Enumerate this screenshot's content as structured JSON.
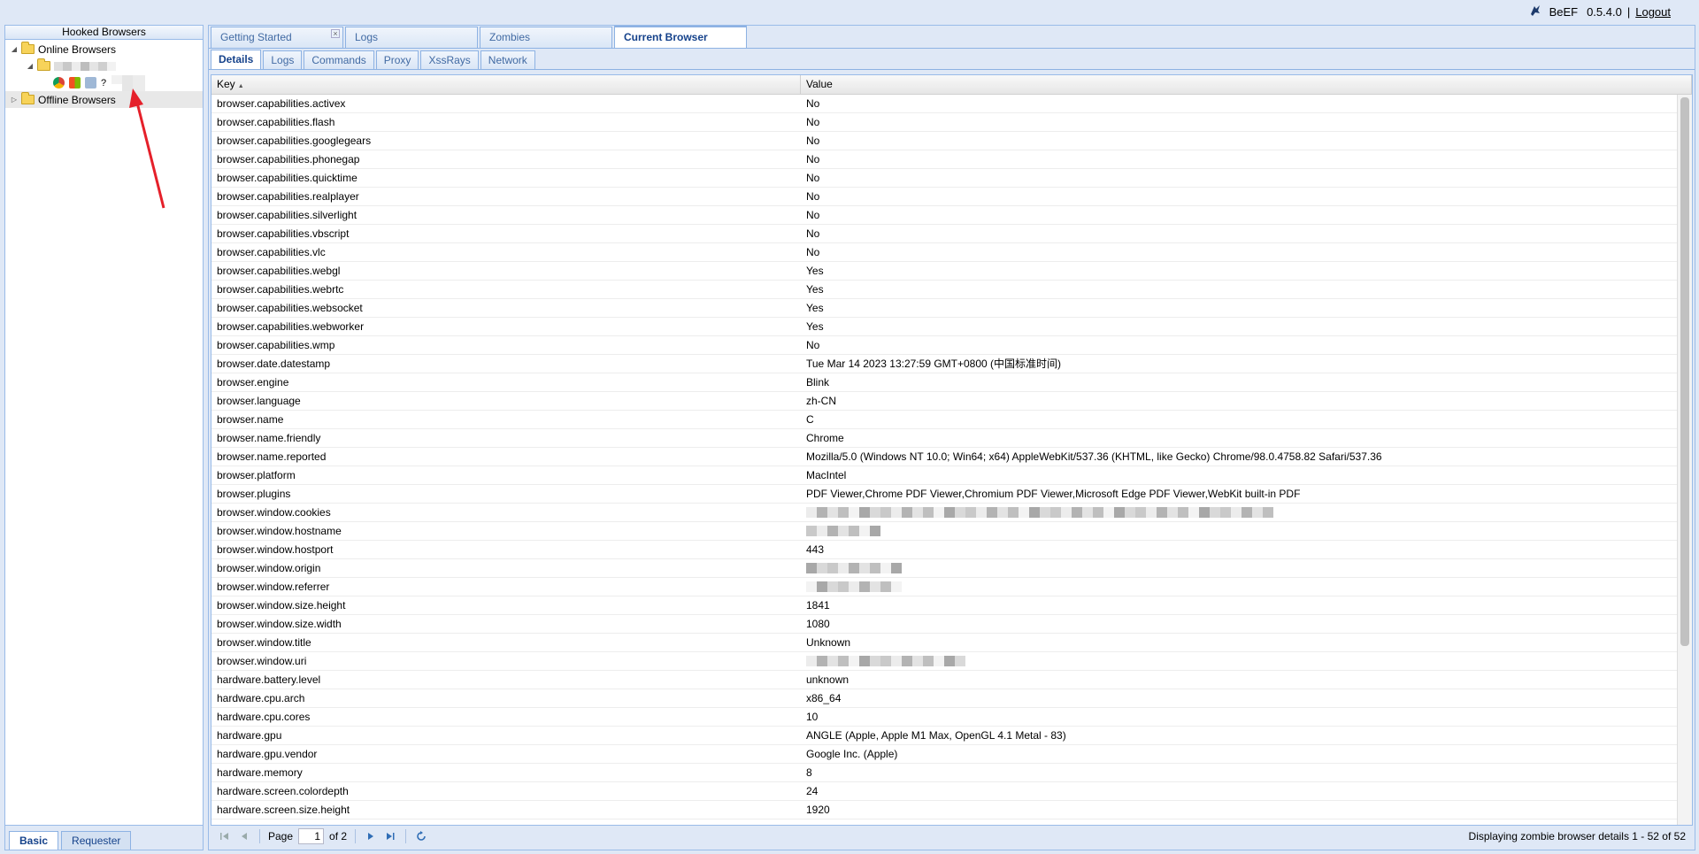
{
  "header": {
    "brand": "BeEF",
    "version": "0.5.4.0",
    "separator": "|",
    "logout_label": "Logout"
  },
  "west": {
    "title": "Hooked Browsers",
    "online_label": "Online Browsers",
    "offline_label": "Offline Browsers",
    "unknown_glyph": "?",
    "tabs": [
      "Basic",
      "Requester"
    ]
  },
  "main_tabs": [
    {
      "label": "Getting Started",
      "closable": true
    },
    {
      "label": "Logs"
    },
    {
      "label": "Zombies"
    },
    {
      "label": "Current Browser",
      "active": true
    }
  ],
  "sub_tabs": [
    {
      "label": "Details",
      "active": true
    },
    {
      "label": "Logs"
    },
    {
      "label": "Commands"
    },
    {
      "label": "Proxy"
    },
    {
      "label": "XssRays"
    },
    {
      "label": "Network"
    }
  ],
  "grid": {
    "col_key": "Key",
    "col_value": "Value",
    "rows": [
      {
        "k": "browser.capabilities.activex",
        "v": "No"
      },
      {
        "k": "browser.capabilities.flash",
        "v": "No"
      },
      {
        "k": "browser.capabilities.googlegears",
        "v": "No"
      },
      {
        "k": "browser.capabilities.phonegap",
        "v": "No"
      },
      {
        "k": "browser.capabilities.quicktime",
        "v": "No"
      },
      {
        "k": "browser.capabilities.realplayer",
        "v": "No"
      },
      {
        "k": "browser.capabilities.silverlight",
        "v": "No"
      },
      {
        "k": "browser.capabilities.vbscript",
        "v": "No"
      },
      {
        "k": "browser.capabilities.vlc",
        "v": "No"
      },
      {
        "k": "browser.capabilities.webgl",
        "v": "Yes"
      },
      {
        "k": "browser.capabilities.webrtc",
        "v": "Yes"
      },
      {
        "k": "browser.capabilities.websocket",
        "v": "Yes"
      },
      {
        "k": "browser.capabilities.webworker",
        "v": "Yes"
      },
      {
        "k": "browser.capabilities.wmp",
        "v": "No"
      },
      {
        "k": "browser.date.datestamp",
        "v": "Tue Mar 14 2023 13:27:59 GMT+0800 (中国标准时间)"
      },
      {
        "k": "browser.engine",
        "v": "Blink"
      },
      {
        "k": "browser.language",
        "v": "zh-CN"
      },
      {
        "k": "browser.name",
        "v": "C"
      },
      {
        "k": "browser.name.friendly",
        "v": "Chrome"
      },
      {
        "k": "browser.name.reported",
        "v": "Mozilla/5.0 (Windows NT 10.0; Win64; x64) AppleWebKit/537.36 (KHTML, like Gecko) Chrome/98.0.4758.82 Safari/537.36"
      },
      {
        "k": "browser.platform",
        "v": "MacIntel"
      },
      {
        "k": "browser.plugins",
        "v": "PDF Viewer,Chrome PDF Viewer,Chromium PDF Viewer,Microsoft Edge PDF Viewer,WebKit built-in PDF"
      },
      {
        "k": "browser.window.cookies",
        "v": "",
        "redacted": 44
      },
      {
        "k": "browser.window.hostname",
        "v": "",
        "redacted": 7
      },
      {
        "k": "browser.window.hostport",
        "v": "443"
      },
      {
        "k": "browser.window.origin",
        "v": "",
        "redacted": 9
      },
      {
        "k": "browser.window.referrer",
        "v": "",
        "redacted": 9
      },
      {
        "k": "browser.window.size.height",
        "v": "1841"
      },
      {
        "k": "browser.window.size.width",
        "v": "1080"
      },
      {
        "k": "browser.window.title",
        "v": "Unknown"
      },
      {
        "k": "browser.window.uri",
        "v": "",
        "redacted": 15
      },
      {
        "k": "hardware.battery.level",
        "v": "unknown"
      },
      {
        "k": "hardware.cpu.arch",
        "v": "x86_64"
      },
      {
        "k": "hardware.cpu.cores",
        "v": "10"
      },
      {
        "k": "hardware.gpu",
        "v": "ANGLE (Apple, Apple M1 Max, OpenGL 4.1 Metal - 83)"
      },
      {
        "k": "hardware.gpu.vendor",
        "v": "Google Inc. (Apple)"
      },
      {
        "k": "hardware.memory",
        "v": "8"
      },
      {
        "k": "hardware.screen.colordepth",
        "v": "24"
      },
      {
        "k": "hardware.screen.size.height",
        "v": "1920"
      }
    ]
  },
  "pager": {
    "page_label": "Page",
    "page_value": "1",
    "of_label": "of 2",
    "info": "Displaying zombie browser details 1 - 52 of 52"
  },
  "colors": {
    "panel_bg": "#dfe8f6",
    "border": "#99bbe8",
    "tab_text": "#15428b",
    "annotation_arrow": "#e5202a"
  }
}
